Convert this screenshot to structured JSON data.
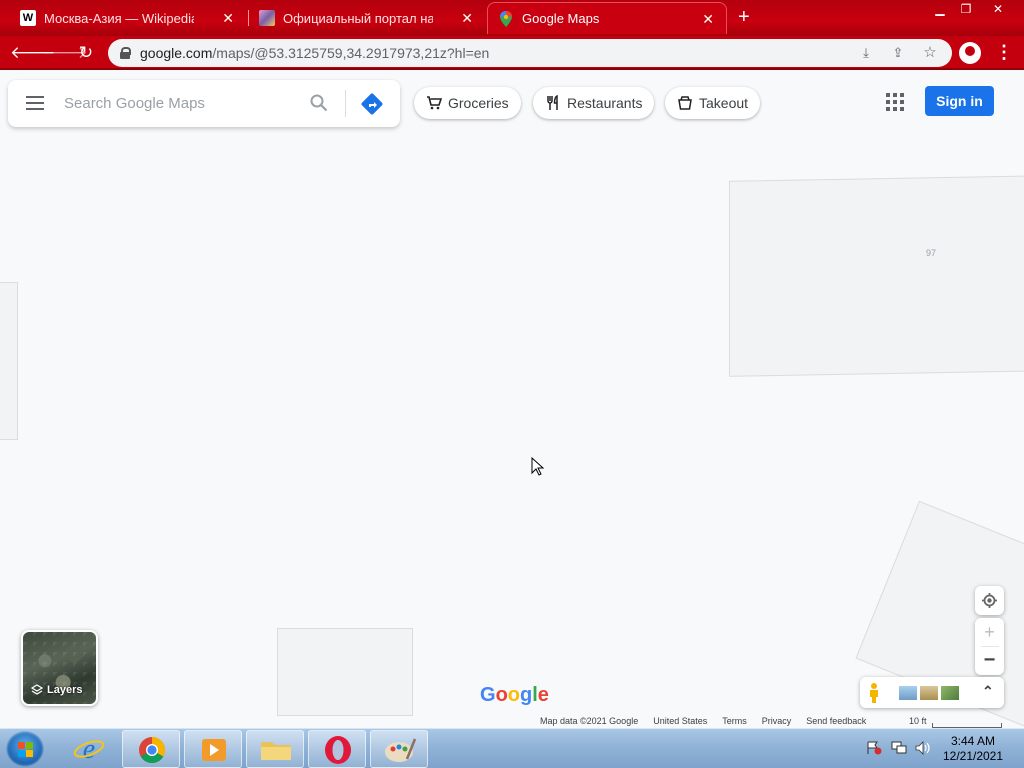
{
  "browser": {
    "tabs": [
      {
        "title": "Москва-Азия — Wikipedia",
        "icon": "wikipedia-icon",
        "favicon_letter": "W",
        "active": false
      },
      {
        "title": "Официальный портал на Y",
        "icon": "portal-icon",
        "active": false
      },
      {
        "title": "Google Maps",
        "icon": "google-maps-pin-icon",
        "active": true
      }
    ],
    "url_host": "google.com",
    "url_path": "/maps/@53.3125759,34.2917973,21z?hl=en",
    "accent_color": "#c4000e"
  },
  "maps": {
    "search_placeholder": "Search Google Maps",
    "chips": [
      "Groceries",
      "Restaurants",
      "Takeout"
    ],
    "sign_in": "Sign in",
    "building_number": "97",
    "layers_label": "Layers",
    "logo_letters": [
      {
        "char": "G",
        "color": "#4285f4"
      },
      {
        "char": "o",
        "color": "#ea4335"
      },
      {
        "char": "o",
        "color": "#fbbc05"
      },
      {
        "char": "g",
        "color": "#4285f4"
      },
      {
        "char": "l",
        "color": "#34a853"
      },
      {
        "char": "e",
        "color": "#ea4335"
      }
    ],
    "attribution": [
      "Map data ©2021 Google",
      "United States",
      "Terms",
      "Privacy",
      "Send feedback"
    ],
    "scale_label": "10 ft",
    "primary_color": "#1a73e8"
  },
  "taskbar": {
    "time": "3:44 AM",
    "date": "12/21/2021",
    "apps": [
      "internet-explorer-icon",
      "chrome-icon",
      "media-player-icon",
      "file-explorer-icon",
      "opera-icon",
      "paint-icon"
    ]
  }
}
